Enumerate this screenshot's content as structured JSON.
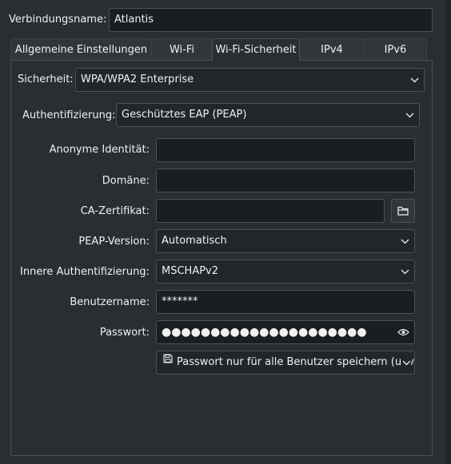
{
  "header": {
    "connection_name_label": "Verbindungsname:",
    "connection_name_value": "Atlantis"
  },
  "tabs": [
    {
      "label": "Allgemeine Einstellungen",
      "active": false
    },
    {
      "label": "Wi-Fi",
      "active": false
    },
    {
      "label": "Wi-Fi-Sicherheit",
      "active": true
    },
    {
      "label": "IPv4",
      "active": false
    },
    {
      "label": "IPv6",
      "active": false
    }
  ],
  "security": {
    "label": "Sicherheit:",
    "value": "WPA/WPA2 Enterprise"
  },
  "authentication": {
    "label": "Authentifizierung:",
    "value": "Geschütztes EAP (PEAP)"
  },
  "form": {
    "anonymous_identity_label": "Anonyme Identität:",
    "anonymous_identity_value": "",
    "domain_label": "Domäne:",
    "domain_value": "",
    "ca_cert_label": "CA-Zertifikat:",
    "ca_cert_value": "",
    "peap_version_label": "PEAP-Version:",
    "peap_version_value": "Automatisch",
    "inner_auth_label": "Innere Authentifizierung:",
    "inner_auth_value": "MSCHAPv2",
    "username_label": "Benutzername:",
    "username_value": "*******",
    "password_label": "Passwort:",
    "password_value": "●●●●●●●●●●●●●●●●●●●●●",
    "password_storage_value": "Passwort nur für alle Benutzer speichern (unv"
  },
  "icons": {
    "folder": "folder-icon",
    "eye": "eye-icon",
    "chevron": "chevron-down-icon",
    "save": "save-icon"
  },
  "colors": {
    "background": "#2a2e32",
    "field": "#1b1e20",
    "border": "#4d5257",
    "text": "#eff0f1"
  }
}
